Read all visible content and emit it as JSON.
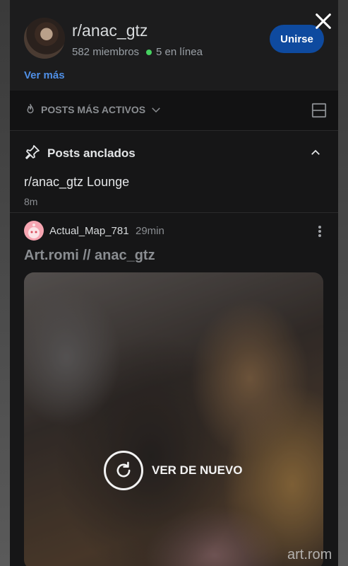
{
  "community": {
    "name": "r/anac_gtz",
    "members": "582 miembros",
    "online": "5 en línea",
    "join_label": "Unirse",
    "see_more": "Ver más"
  },
  "sort": {
    "label": "POSTS MÁS ACTIVOS"
  },
  "pinned": {
    "title": "Posts anclados",
    "items": [
      {
        "title": "r/anac_gtz Lounge",
        "time": "8m"
      }
    ]
  },
  "post": {
    "author": "Actual_Map_781",
    "time": "29min",
    "title": "Art.romi // anac_gtz",
    "replay_label": "VER DE NUEVO",
    "watermark": "art.rom"
  },
  "colors": {
    "accent": "#0e4a9f",
    "link": "#4f8fe6",
    "online_dot": "#46d160",
    "sheet_bg": "#161617"
  },
  "icons": [
    "close-icon",
    "flame-icon",
    "chevron-down-icon",
    "card-layout-icon",
    "pin-icon",
    "chevron-up-icon",
    "more-vertical-icon",
    "replay-icon"
  ]
}
